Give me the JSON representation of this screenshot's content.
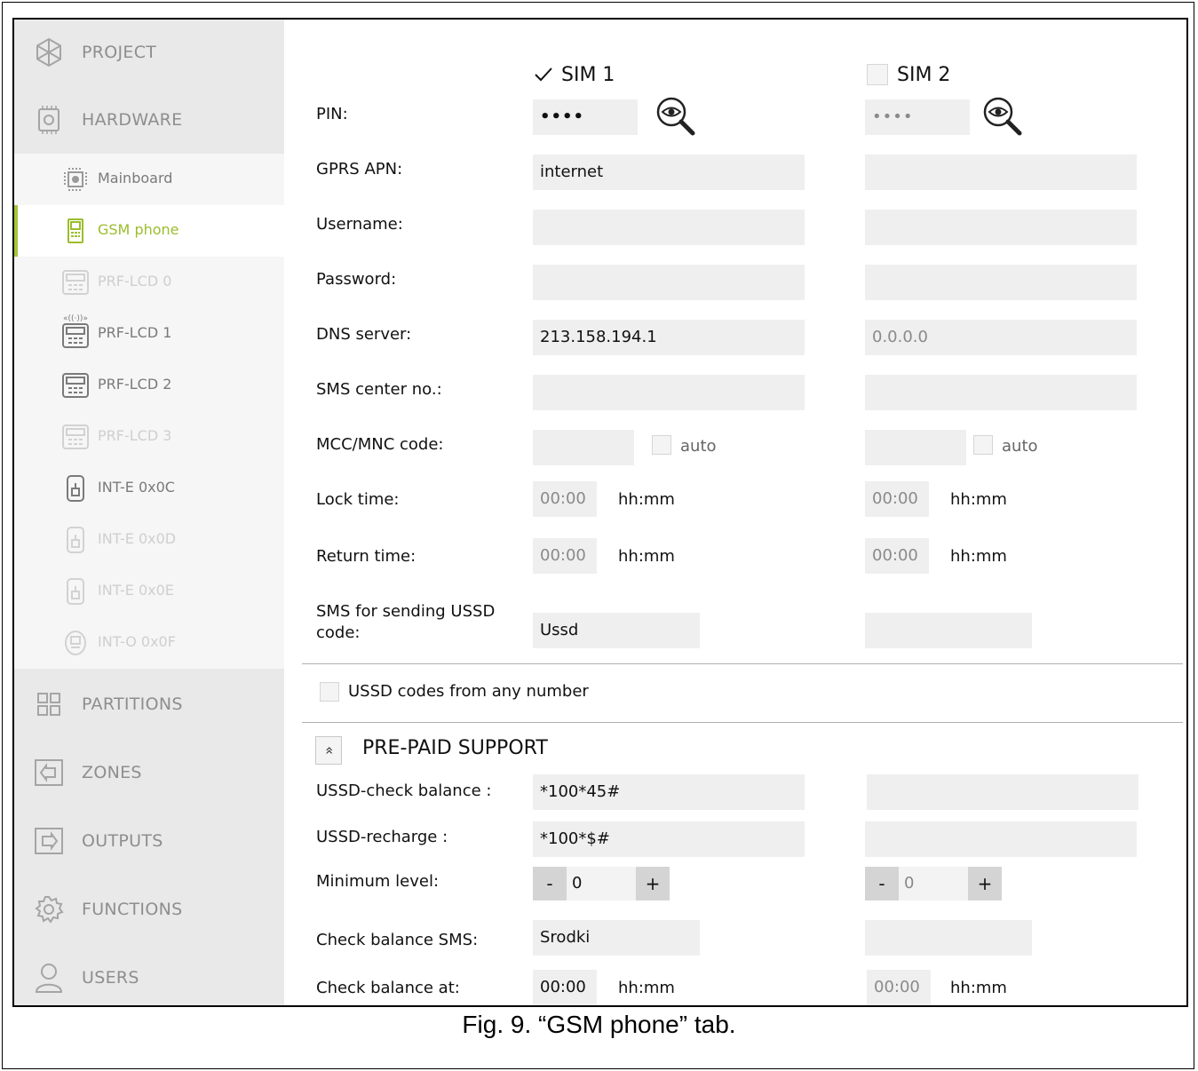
{
  "sidebar": {
    "main_top": [
      {
        "label": "PROJECT",
        "icon": "project-icon"
      },
      {
        "label": "HARDWARE",
        "icon": "hardware-icon"
      }
    ],
    "sub_items": [
      {
        "label": "Mainboard",
        "icon": "chip-icon",
        "state": "normal"
      },
      {
        "label": "GSM phone",
        "icon": "phone-icon",
        "state": "active"
      },
      {
        "label": "PRF-LCD 0",
        "icon": "keypad-icon",
        "state": "dim"
      },
      {
        "label": "PRF-LCD 1",
        "icon": "wireless-keypad-icon",
        "state": "normal"
      },
      {
        "label": "PRF-LCD 2",
        "icon": "keypad-icon",
        "state": "normal"
      },
      {
        "label": "PRF-LCD 3",
        "icon": "keypad-icon",
        "state": "dim"
      },
      {
        "label": "INT-E 0x0C",
        "icon": "expander-icon",
        "state": "normal"
      },
      {
        "label": "INT-E 0x0D",
        "icon": "expander-icon",
        "state": "dim"
      },
      {
        "label": "INT-E 0x0E",
        "icon": "expander-icon",
        "state": "dim"
      },
      {
        "label": "INT-O 0x0F",
        "icon": "output-expander-icon",
        "state": "dim"
      }
    ],
    "main_bottom": [
      {
        "label": "PARTITIONS",
        "icon": "partitions-icon"
      },
      {
        "label": "ZONES",
        "icon": "zones-icon"
      },
      {
        "label": "OUTPUTS",
        "icon": "outputs-icon"
      },
      {
        "label": "FUNCTIONS",
        "icon": "gear-icon"
      },
      {
        "label": "USERS",
        "icon": "user-icon"
      }
    ]
  },
  "sim1": {
    "label": "SIM 1",
    "checked": true
  },
  "sim2": {
    "label": "SIM 2",
    "checked": false
  },
  "labels": {
    "pin": "PIN:",
    "apn": "GPRS APN:",
    "username": "Username:",
    "password": "Password:",
    "dns": "DNS server:",
    "sms_center": "SMS center no.:",
    "mcc": "MCC/MNC code:",
    "lock_time": "Lock time:",
    "return_time": "Return time:",
    "ussd_sms_1": "SMS for sending USSD",
    "ussd_sms_2": "code:",
    "ussd_any": "USSD codes from any number",
    "prepaid": "PRE-PAID SUPPORT",
    "check_balance": "USSD-check balance :",
    "recharge": "USSD-recharge :",
    "min_level": "Minimum level:",
    "check_sms": "Check balance SMS:",
    "check_at": "Check balance at:",
    "auto": "auto",
    "hhmm": "hh:mm"
  },
  "values": {
    "sim1": {
      "pin": "••••",
      "apn": "internet",
      "username": "",
      "password": "",
      "dns": "213.158.194.1",
      "sms_center": "",
      "mcc": "",
      "lock_time": "00:00",
      "return_time": "00:00",
      "ussd_sms": "Ussd",
      "check_balance": "*100*45#",
      "recharge": "*100*$#",
      "min_level": "0",
      "check_sms": "Srodki",
      "check_at": "00:00"
    },
    "sim2": {
      "pin": "••••",
      "apn": "",
      "username": "",
      "password": "",
      "dns": "0.0.0.0",
      "sms_center": "",
      "mcc": "",
      "lock_time": "00:00",
      "return_time": "00:00",
      "ussd_sms": "",
      "check_balance": "",
      "recharge": "",
      "min_level": "0",
      "check_sms": "",
      "check_at": "00:00"
    }
  },
  "stepper": {
    "minus": "-",
    "plus": "+"
  },
  "collapse_glyph": "«",
  "caption": "Fig. 9. “GSM phone” tab.",
  "colors": {
    "accent": "#9bbd2d",
    "sidebar": "#e9e9e9",
    "field": "#efefef"
  }
}
